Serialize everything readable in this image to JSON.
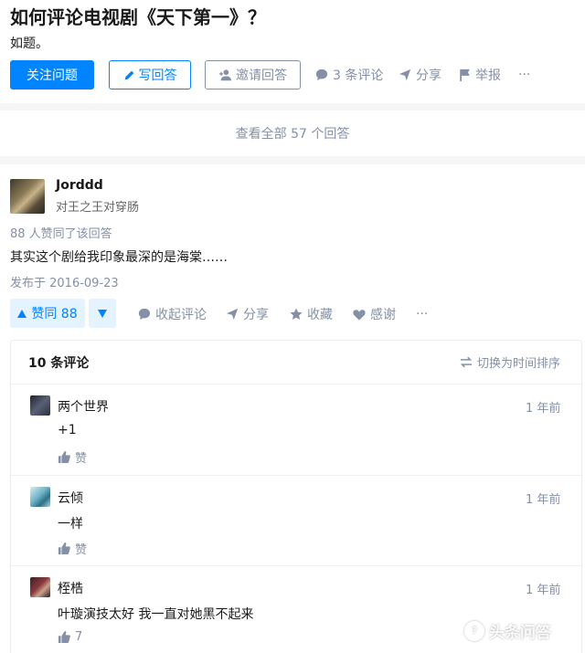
{
  "question": {
    "title": "如何评论电视剧《天下第一》？",
    "description": "如题。",
    "follow_label": "关注问题",
    "write_label": "写回答",
    "invite_label": "邀请回答",
    "comments_label": "3 条评论",
    "share_label": "分享",
    "report_label": "举报",
    "more_label": "···"
  },
  "view_all_label": "查看全部 57 个回答",
  "answer": {
    "author_name": "Jorddd",
    "author_bio": "对王之王对穿肠",
    "vote_summary": "88 人赞同了该回答",
    "text": "其实这个剧给我印象最深的是海棠……",
    "publish_date": "发布于 2016-09-23",
    "upvote_label": "赞同 88",
    "collapse_comments_label": "收起评论",
    "share_label": "分享",
    "favorite_label": "收藏",
    "thanks_label": "感谢",
    "more_label": "···"
  },
  "comments": {
    "header": "10 条评论",
    "sort_label": "切换为时间排序",
    "items": [
      {
        "author": "两个世界",
        "time": "1 年前",
        "text": "+1",
        "like_label": "赞"
      },
      {
        "author": "云倾",
        "time": "1 年前",
        "text": "一样",
        "like_label": "赞"
      },
      {
        "author": "桎梏",
        "time": "1 年前",
        "text": "叶璇演技太好 我一直对她黑不起来",
        "like_label": "7"
      }
    ]
  },
  "watermark": "头条问答",
  "colors": {
    "accent": "#0084ff",
    "muted": "#8590a6",
    "upvote_bg": "#e5f2ff"
  }
}
